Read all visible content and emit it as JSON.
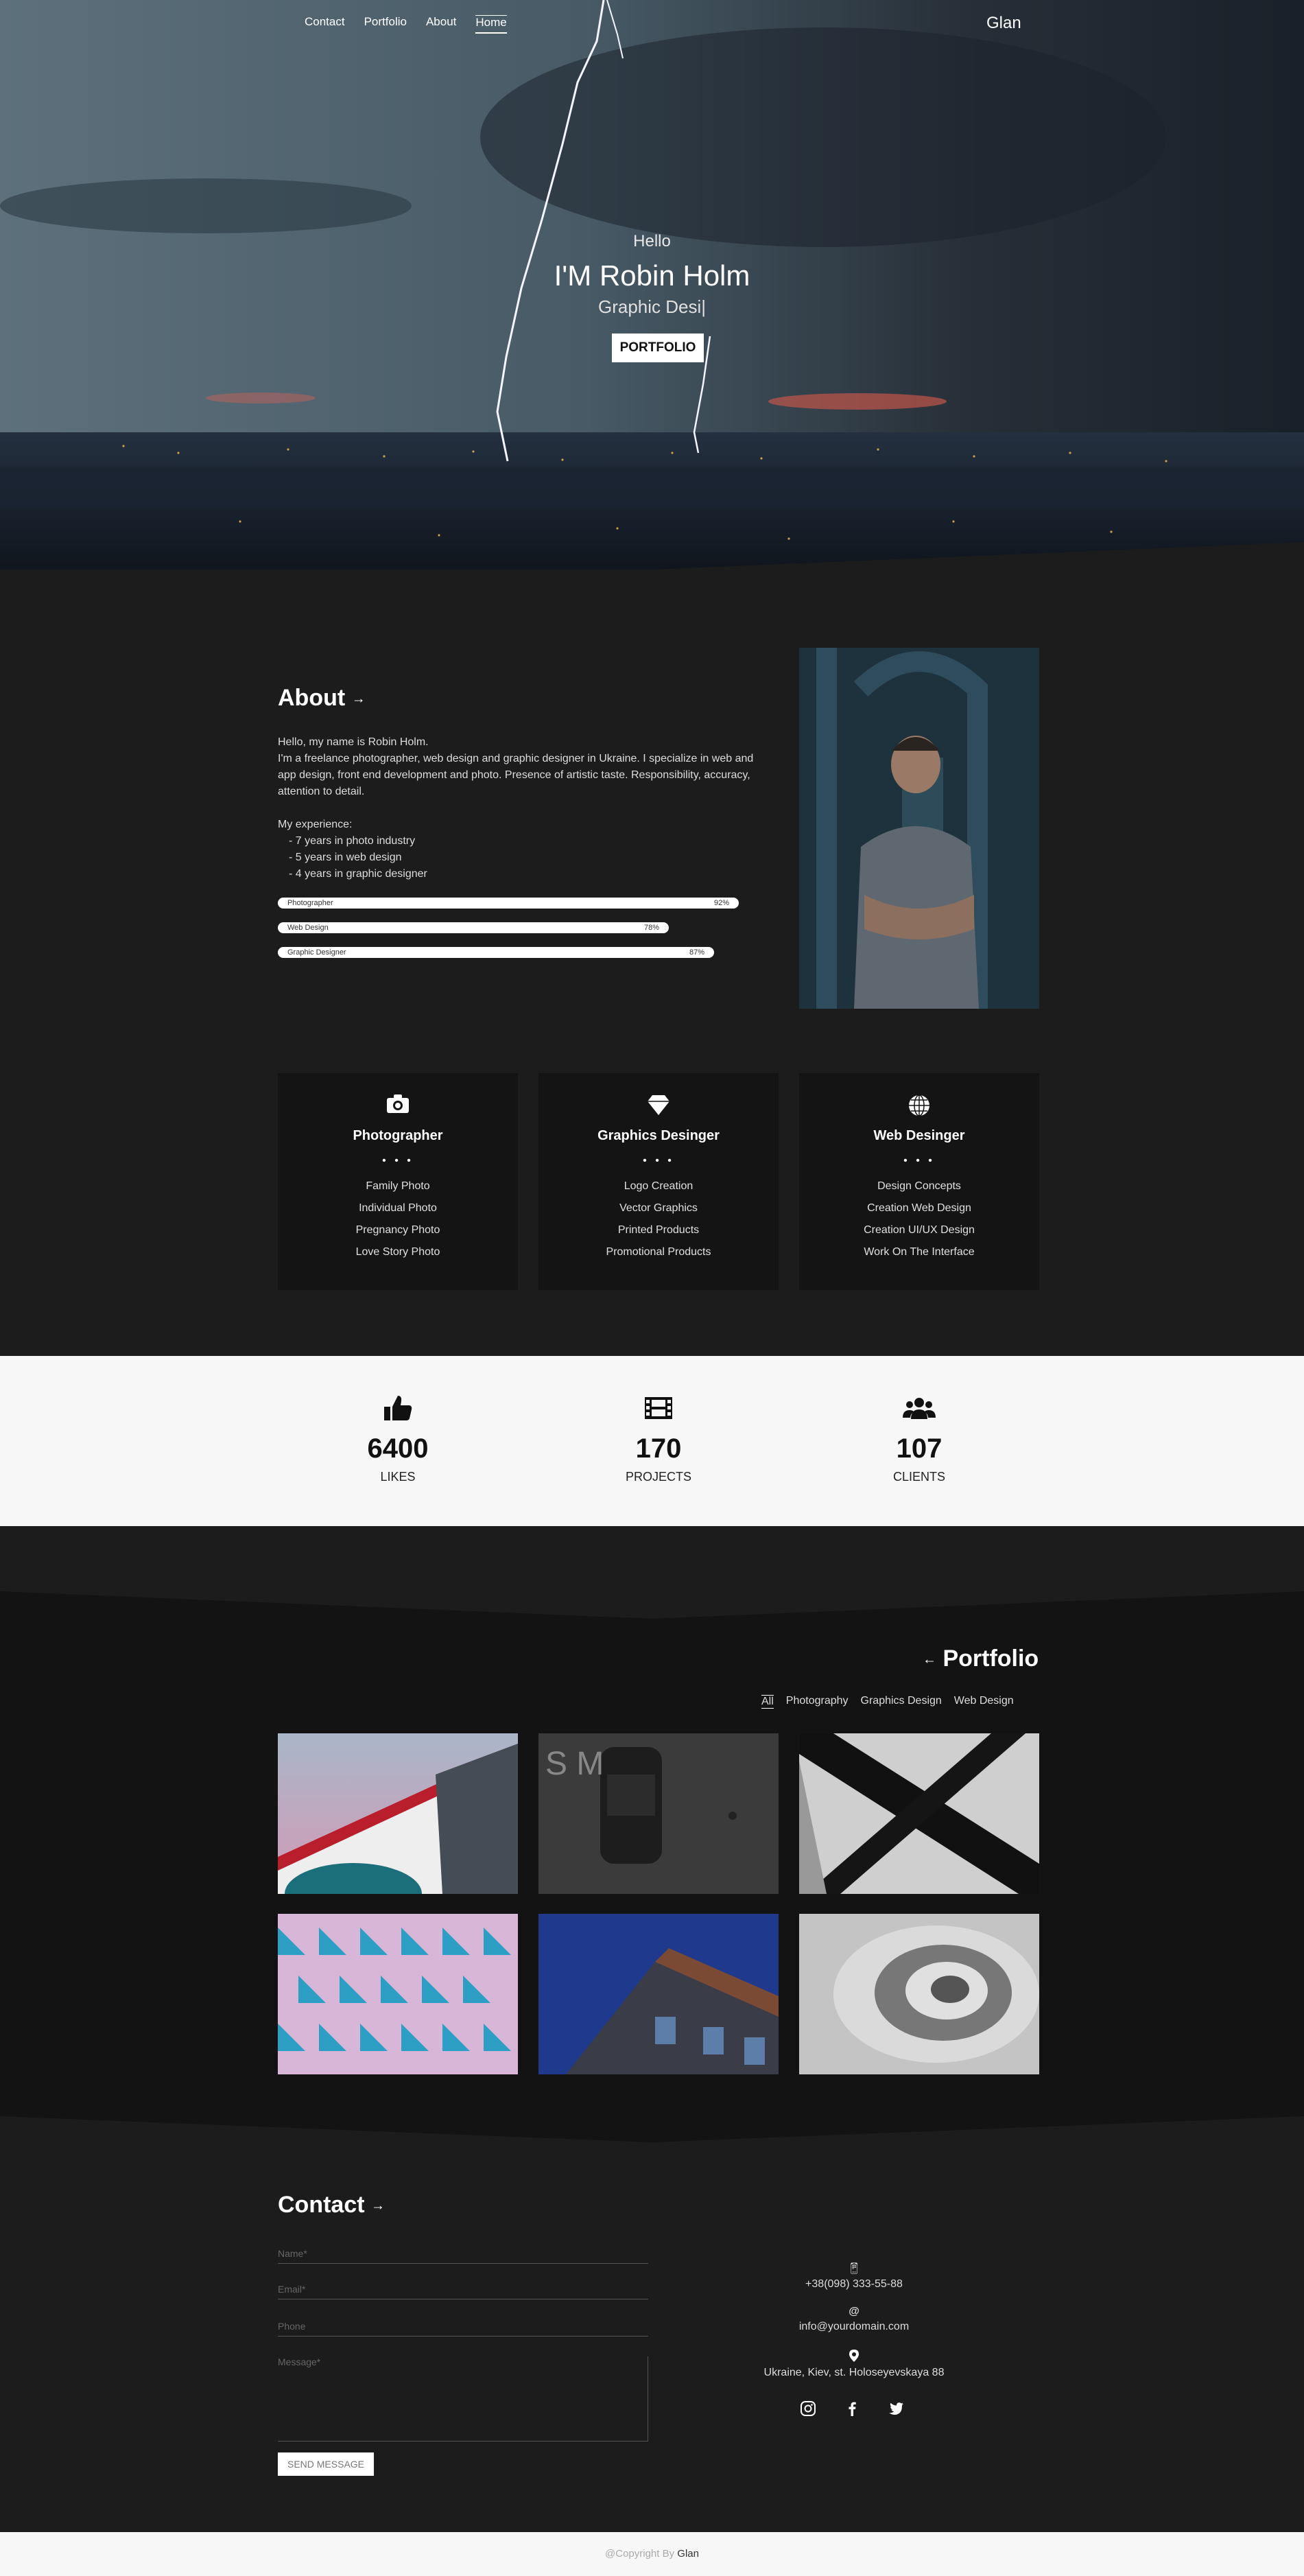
{
  "nav": {
    "items": [
      "Contact",
      "Portfolio",
      "About",
      "Home"
    ],
    "active": "Home"
  },
  "brand": {
    "logo": "Glan"
  },
  "hero": {
    "greeting": "Hello",
    "name": "I'M Robin Holm",
    "role": "Graphic Desi|",
    "button": "PORTFOLIO"
  },
  "about": {
    "title": "About",
    "intro": "Hello, my name is Robin Holm.",
    "bio": "I'm a freelance photographer, web design and graphic designer in Ukraine. I specialize in web and app design, front end development and photo. Presence of artistic taste. Responsibility, accuracy, attention to detail.",
    "experience_label": "My experience:",
    "experience": [
      "- 7 years in photo industry",
      "- 5 years in web design",
      "- 4 years in graphic designer"
    ],
    "skills": [
      {
        "name": "Photographer",
        "value": "92%",
        "pct": 92
      },
      {
        "name": "Web Design",
        "value": "78%",
        "pct": 78
      },
      {
        "name": "Graphic Designer",
        "value": "87%",
        "pct": 87
      }
    ]
  },
  "services": [
    {
      "icon": "camera-icon",
      "title": "Photographer",
      "items": [
        "Family Photo",
        "Individual Photo",
        "Pregnancy Photo",
        "Love Story Photo"
      ]
    },
    {
      "icon": "diamond-icon",
      "title": "Graphics Desinger",
      "items": [
        "Logo Creation",
        "Vector Graphics",
        "Printed Products",
        "Promotional Products"
      ]
    },
    {
      "icon": "globe-icon",
      "title": "Web Desinger",
      "items": [
        "Design Concepts",
        "Creation Web Design",
        "Creation UI/UX Design",
        "Work On The Interface"
      ]
    }
  ],
  "dots": "• • •",
  "stats": [
    {
      "icon": "thumbs-up-icon",
      "value": "6400",
      "label": "LIKES"
    },
    {
      "icon": "film-icon",
      "value": "170",
      "label": "PROJECTS"
    },
    {
      "icon": "users-icon",
      "value": "107",
      "label": "CLIENTS"
    }
  ],
  "portfolio": {
    "title": "Portfolio",
    "filters": [
      "All",
      "Photography",
      "Graphics Design",
      "Web Design"
    ],
    "active_filter": "All"
  },
  "contact": {
    "title": "Contact",
    "name_placeholder": "Name*",
    "email_placeholder": "Email*",
    "phone_placeholder": "Phone",
    "message_placeholder": "Message*",
    "send_label": "SEND MESSAGE",
    "phone": "+38(098) 333-55-88",
    "email": "info@yourdomain.com",
    "address": "Ukraine, Kiev, st. Holoseyevskaya 88"
  },
  "footer": {
    "copyright": "@Copyright By",
    "brand": "Glan"
  }
}
